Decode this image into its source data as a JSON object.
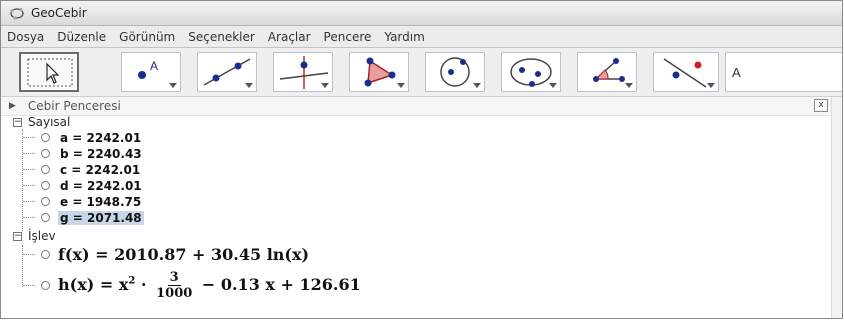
{
  "window": {
    "title": "GeoCebir"
  },
  "menu": [
    "Dosya",
    "Düzenle",
    "Görünüm",
    "Seçenekler",
    "Araçlar",
    "Pencere",
    "Yardım"
  ],
  "toolbar": {
    "tools": [
      {
        "name": "move-tool",
        "icon": "cursor-arrow-icon",
        "active": true
      },
      {
        "name": "point-tool",
        "icon": "point-a-icon"
      },
      {
        "name": "line-tool",
        "icon": "line-through-points-icon"
      },
      {
        "name": "perpendicular-tool",
        "icon": "perpendicular-line-icon"
      },
      {
        "name": "polygon-tool",
        "icon": "polygon-icon"
      },
      {
        "name": "circle-tool",
        "icon": "circle-center-point-icon"
      },
      {
        "name": "ellipse-tool",
        "icon": "ellipse-icon"
      },
      {
        "name": "angle-tool",
        "icon": "angle-icon"
      },
      {
        "name": "reflect-tool",
        "icon": "reflect-about-line-icon"
      }
    ]
  },
  "algebra": {
    "panel_title": "Cebir Penceresi",
    "close_glyph": "x",
    "groups": [
      {
        "label": "Sayısal",
        "items": [
          {
            "text": "a = 2242.01"
          },
          {
            "text": "b = 2240.43"
          },
          {
            "text": "c = 2242.01"
          },
          {
            "text": "d = 2242.01"
          },
          {
            "text": "e = 1948.75"
          },
          {
            "text": "g = 2071.48",
            "selected": true
          }
        ]
      },
      {
        "label": "İşlev",
        "functions": [
          {
            "f_expr": "f(x) = 2010.87 + 30.45 ln(x)"
          },
          {
            "h_lhs": "h(x) = x",
            "h_exp": "2",
            "h_dot": "·",
            "h_num": "3",
            "h_den": "1000",
            "h_rest": "− 0.13 x + 126.61"
          }
        ]
      }
    ]
  },
  "colors": {
    "accent": "#1e3f9a",
    "selection": "#c8d6ea",
    "point": "#1a2e8c",
    "red": "#cc2222"
  }
}
